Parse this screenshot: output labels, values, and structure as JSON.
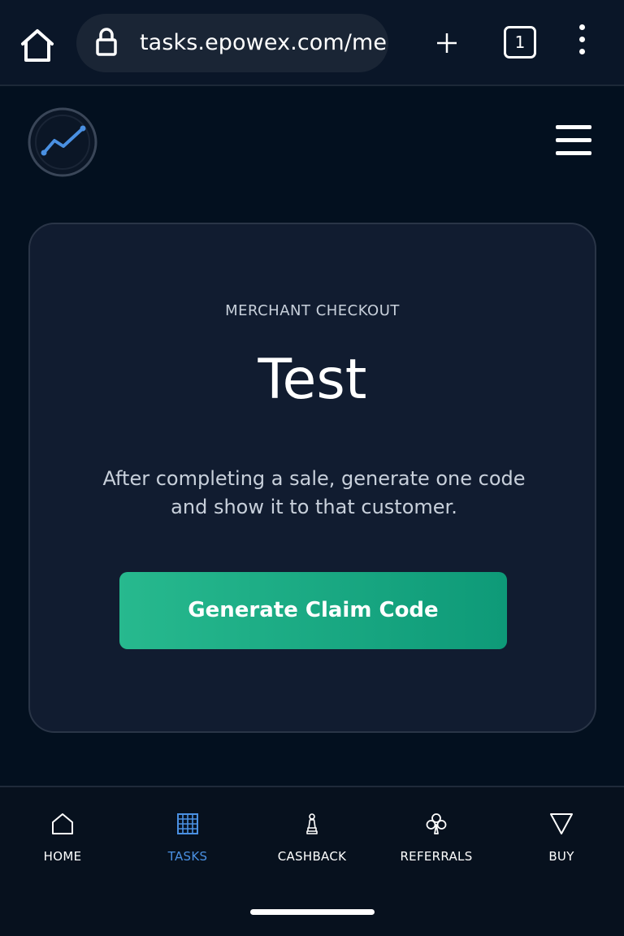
{
  "browser": {
    "url": "tasks.epowex.com/merchant",
    "tab_count": "1"
  },
  "card": {
    "eyebrow": "MERCHANT CHECKOUT",
    "merchant_name": "Test",
    "description": "After completing a sale, generate one code and show it to that customer.",
    "button_label": "Generate Claim Code"
  },
  "nav": {
    "items": [
      {
        "label": "HOME",
        "icon": "home-icon"
      },
      {
        "label": "TASKS",
        "icon": "grid-icon",
        "active": true
      },
      {
        "label": "CASHBACK",
        "icon": "chess-pawn-icon"
      },
      {
        "label": "REFERRALS",
        "icon": "club-icon"
      },
      {
        "label": "BUY",
        "icon": "triangle-down-icon"
      }
    ]
  },
  "colors": {
    "accent": "#4a90e2",
    "button": "#1aa985",
    "background": "#03101f",
    "card": "#111c30"
  }
}
